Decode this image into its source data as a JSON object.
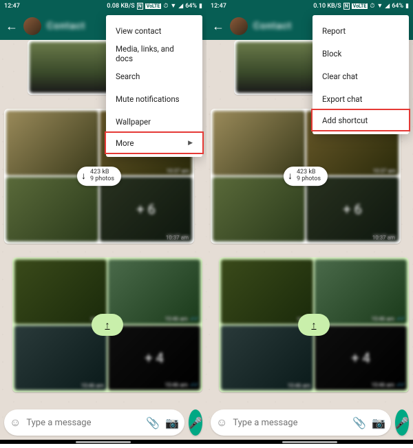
{
  "status": {
    "time": "12:47",
    "data_rate": "0.08 KB/S",
    "data_rate2": "0.10 KB/S",
    "nfc": "N",
    "volte": "VoLTE",
    "battery": "64%",
    "contact_name_masked": "Contact"
  },
  "menu_left": {
    "items": [
      "View contact",
      "Media, links, and docs",
      "Search",
      "Mute notifications",
      "Wallpaper",
      "More"
    ],
    "highlight_index": 5
  },
  "menu_right": {
    "items": [
      "Report",
      "Block",
      "Clear chat",
      "Export chat",
      "Add shortcut"
    ],
    "highlight_index": 4
  },
  "album_in": {
    "size_label": "423 kB",
    "count_label": "9 photos",
    "overlay_count": "+ 6",
    "timestamps": [
      "10:37 am",
      "10:37 am"
    ],
    "bottom_time": "10:37 am"
  },
  "album_out": {
    "overlay_count": "+ 4",
    "timestamps": [
      "10:46",
      "10:46 am",
      "10:46 am",
      "10:46 am"
    ]
  },
  "input": {
    "placeholder": "Type a message"
  }
}
